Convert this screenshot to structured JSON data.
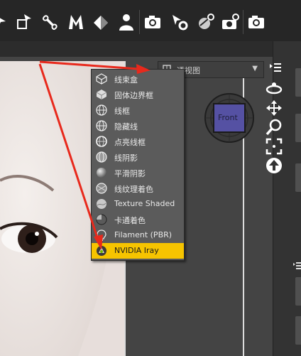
{
  "colors": {
    "accent": "#f6c400",
    "arrow": "#e8291c",
    "gizmo": "#5551a3"
  },
  "view_dropdown": {
    "label": "透视图"
  },
  "gizmo": {
    "label": "Front"
  },
  "menu": {
    "items": [
      {
        "label": "线束盒",
        "icon": "wire-box-icon"
      },
      {
        "label": "固体边界框",
        "icon": "solid-box-icon"
      },
      {
        "label": "线框",
        "icon": "wireframe-icon"
      },
      {
        "label": "隐藏线",
        "icon": "hidden-line-icon"
      },
      {
        "label": "点亮线框",
        "icon": "lit-wireframe-icon"
      },
      {
        "label": "线阴影",
        "icon": "wire-shaded-icon"
      },
      {
        "label": "平滑阴影",
        "icon": "smooth-shaded-icon"
      },
      {
        "label": "线纹理着色",
        "icon": "wire-texture-icon"
      },
      {
        "label": "Texture Shaded",
        "icon": "texture-shaded-icon"
      },
      {
        "label": "卡通着色",
        "icon": "cartoon-shaded-icon"
      },
      {
        "label": "Filament (PBR)",
        "icon": "filament-icon"
      },
      {
        "label": "NVIDIA Iray",
        "icon": "iray-icon",
        "selected": true
      }
    ]
  }
}
